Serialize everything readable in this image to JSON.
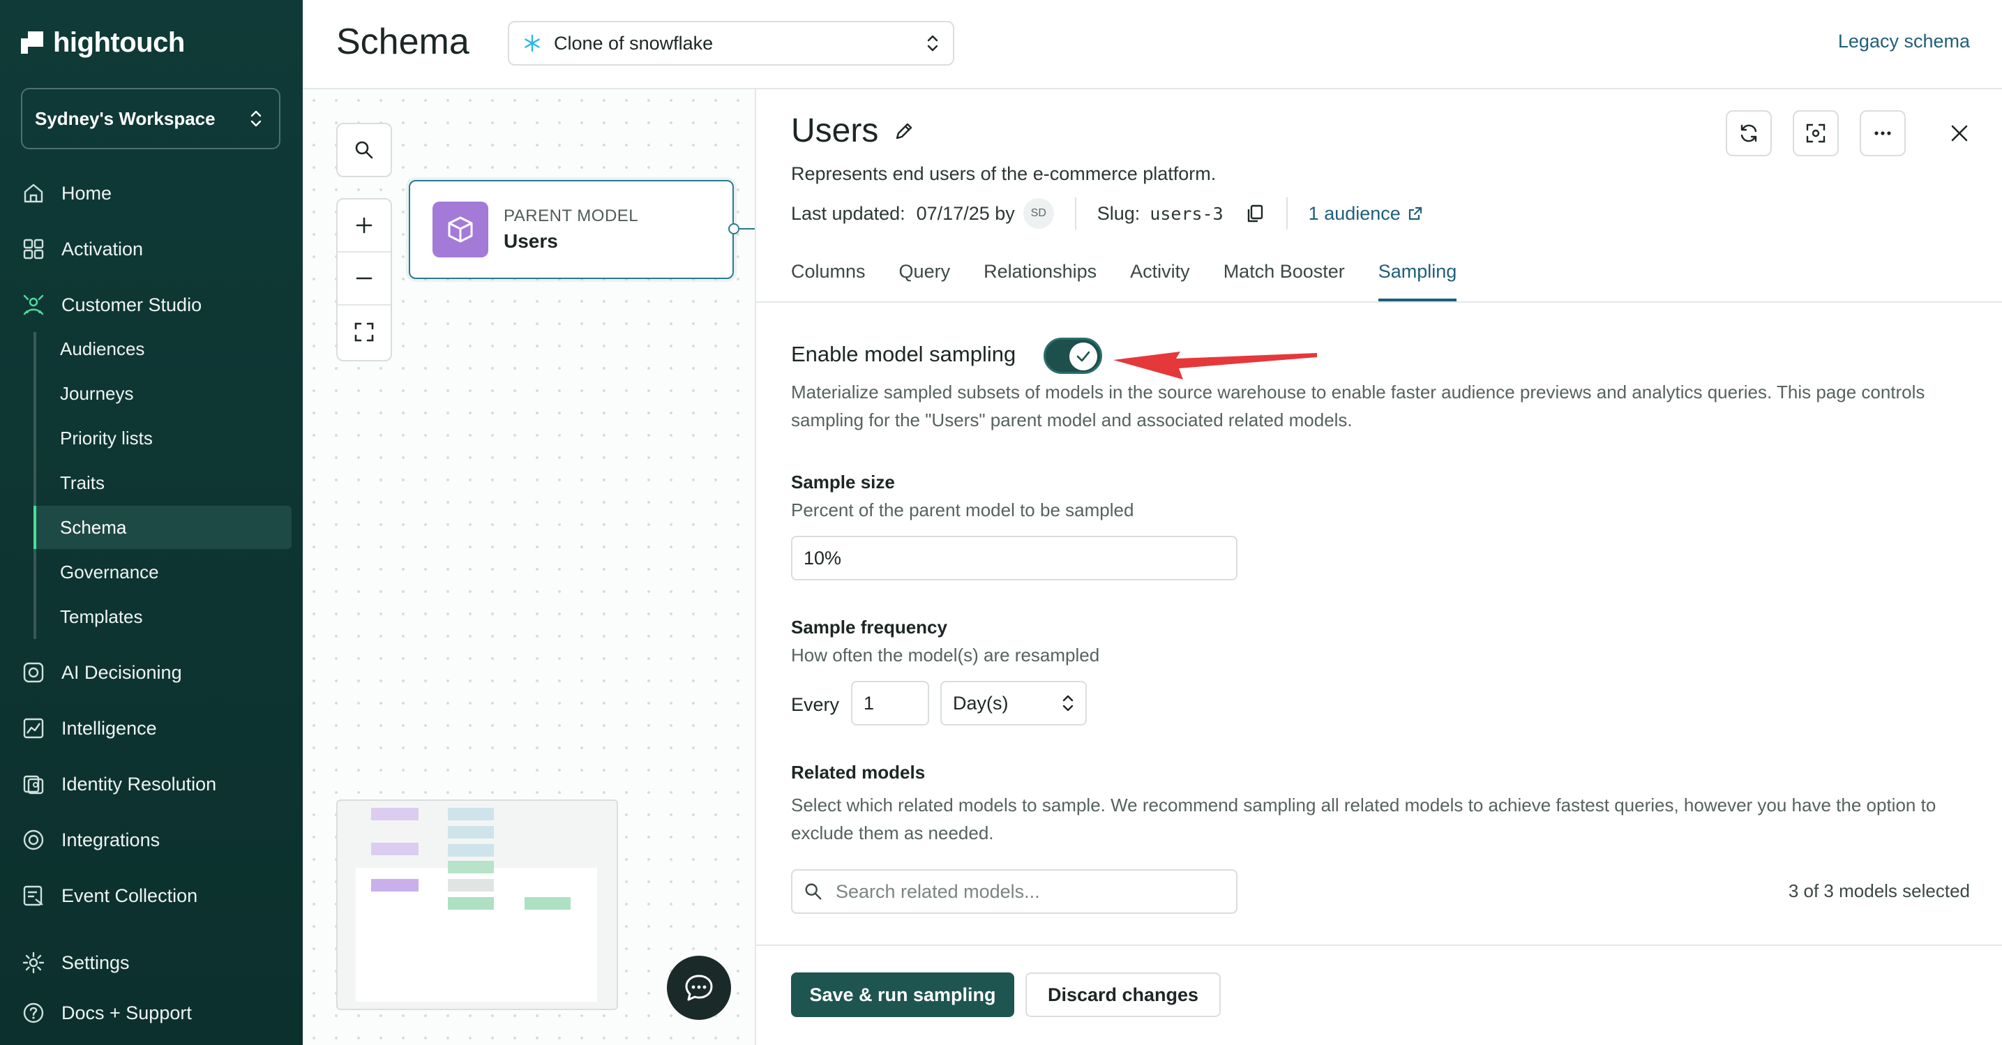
{
  "app": {
    "logo_text": "hightouch"
  },
  "sidebar": {
    "workspace": "Sydney's Workspace",
    "items": [
      {
        "label": "Home",
        "icon": "home-icon"
      },
      {
        "label": "Activation",
        "icon": "grid-icon"
      },
      {
        "label": "Customer Studio",
        "icon": "users-network-icon"
      }
    ],
    "sub_items": [
      {
        "label": "Audiences"
      },
      {
        "label": "Journeys"
      },
      {
        "label": "Priority lists"
      },
      {
        "label": "Traits"
      },
      {
        "label": "Schema",
        "active": true
      },
      {
        "label": "Governance"
      },
      {
        "label": "Templates"
      }
    ],
    "items_bottom": [
      {
        "label": "AI Decisioning",
        "icon": "ai-icon"
      },
      {
        "label": "Intelligence",
        "icon": "chart-icon"
      },
      {
        "label": "Identity Resolution",
        "icon": "identity-icon"
      },
      {
        "label": "Integrations",
        "icon": "integrations-icon"
      },
      {
        "label": "Event Collection",
        "icon": "event-icon"
      },
      {
        "label": "Settings",
        "icon": "gear-icon"
      },
      {
        "label": "Docs + Support",
        "icon": "help-icon"
      }
    ]
  },
  "header": {
    "title": "Schema",
    "source_select": "Clone of snowflake",
    "legacy_link": "Legacy schema"
  },
  "canvas": {
    "model_kicker": "PARENT MODEL",
    "model_name": "Users"
  },
  "panel": {
    "title": "Users",
    "description": "Represents end users of the e-commerce platform.",
    "last_updated_label": "Last updated:",
    "last_updated_value": "07/17/25 by",
    "avatar_initials": "SD",
    "slug_label": "Slug:",
    "slug_value": "users-3",
    "audience_link": "1 audience",
    "tabs": [
      "Columns",
      "Query",
      "Relationships",
      "Activity",
      "Match Booster",
      "Sampling"
    ],
    "active_tab": "Sampling",
    "sampling": {
      "enable_label": "Enable model sampling",
      "enabled": true,
      "description": "Materialize sampled subsets of models in the source warehouse to enable faster audience previews and analytics queries. This page controls sampling for the \"Users\" parent model and associated related models.",
      "size_label": "Sample size",
      "size_help": "Percent of the parent model to be sampled",
      "size_value": "10%",
      "freq_label": "Sample frequency",
      "freq_help": "How often the model(s) are resampled",
      "every_label": "Every",
      "freq_value": "1",
      "freq_unit": "Day(s)",
      "related_label": "Related models",
      "related_help": "Select which related models to sample. We recommend sampling all related models to achieve fastest queries, however you have the option to exclude them as needed.",
      "search_placeholder": "Search related models...",
      "selected_count": "3 of 3 models selected"
    },
    "buttons": {
      "save": "Save & run sampling",
      "discard": "Discard changes"
    }
  },
  "colors": {
    "sidebar_bg": "#0f3a37",
    "accent": "#1f5f7a",
    "primary_button": "#1e5550",
    "model_icon": "#a47ad8",
    "annotation_arrow": "#e5383b"
  }
}
